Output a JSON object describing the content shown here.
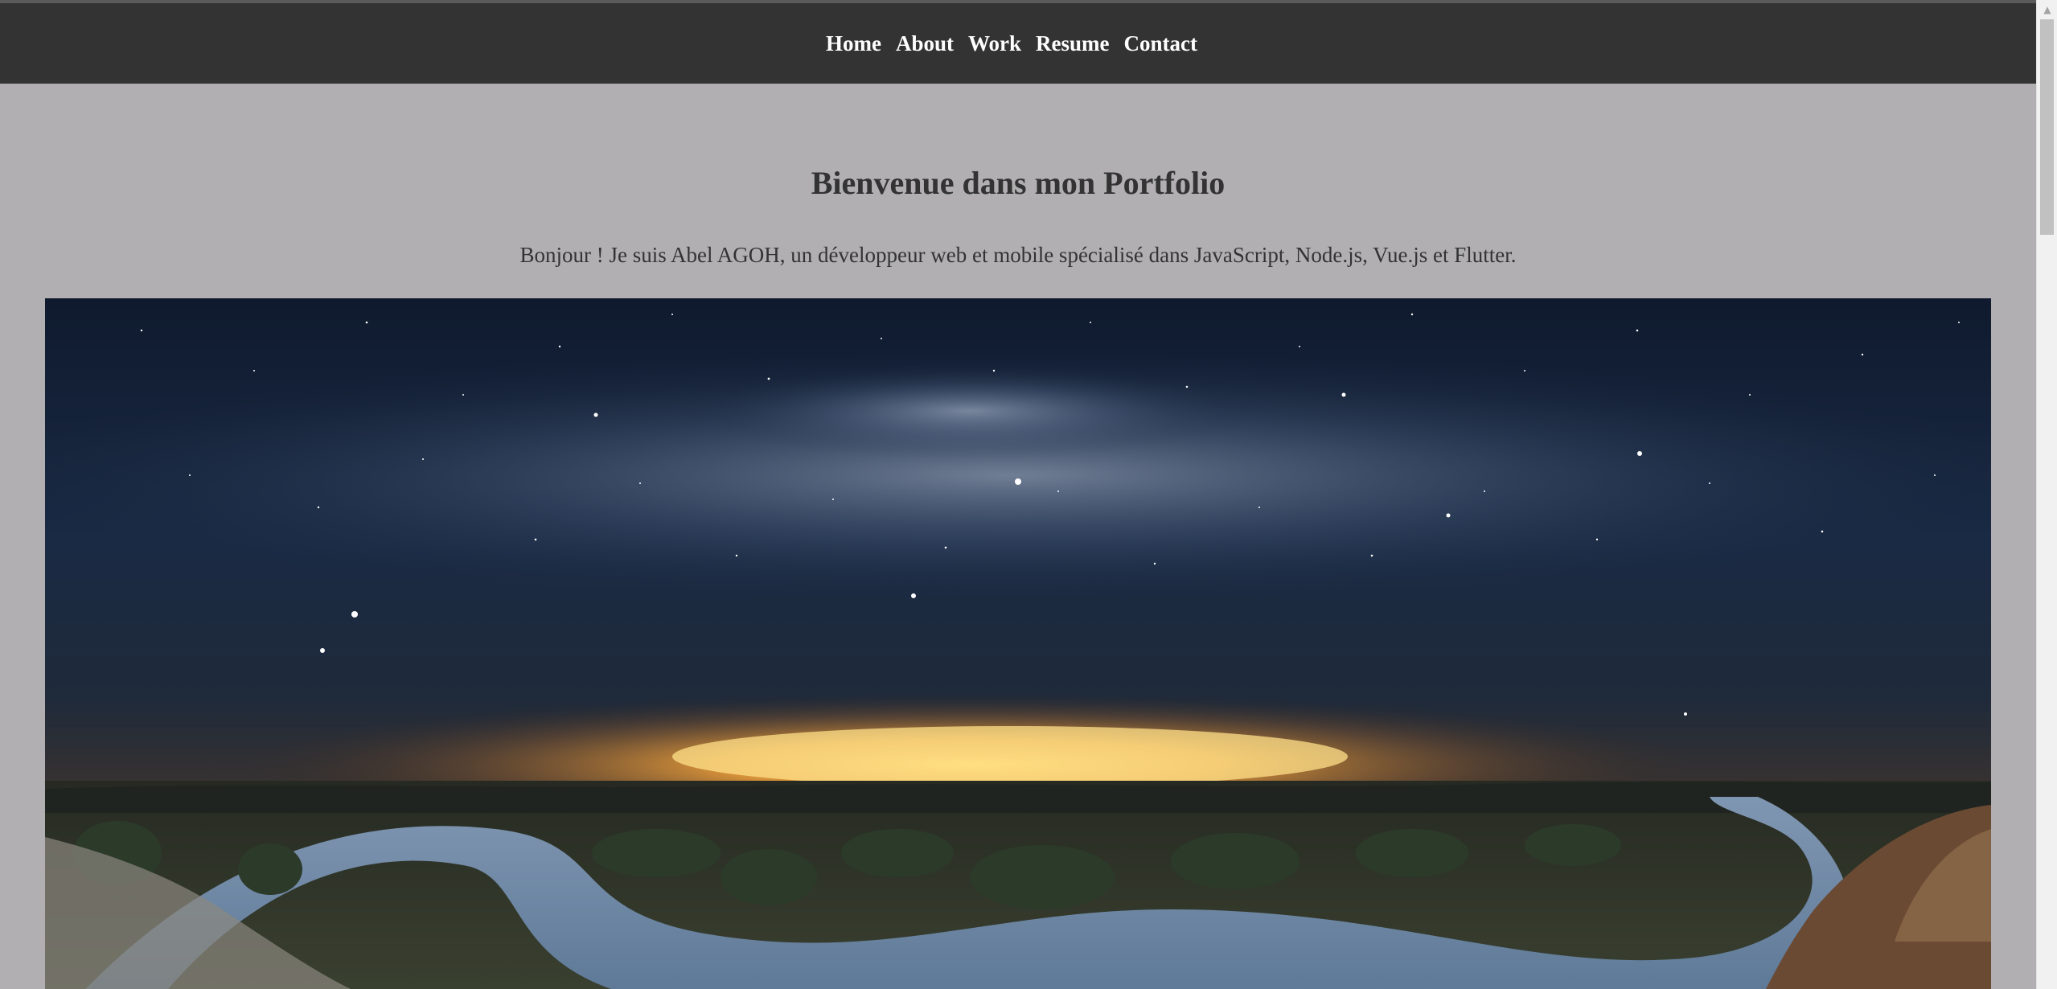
{
  "nav": {
    "items": [
      {
        "label": "Home"
      },
      {
        "label": "About"
      },
      {
        "label": "Work"
      },
      {
        "label": "Resume"
      },
      {
        "label": "Contact"
      }
    ]
  },
  "main": {
    "title": "Bienvenue dans mon Portfolio",
    "intro": "Bonjour ! Je suis Abel AGOH, un développeur web et mobile spécialisé dans JavaScript, Node.js, Vue.js et Flutter."
  },
  "scrollbar": {
    "up_icon": "arrow-up-icon"
  },
  "colors": {
    "navbar_bg": "#333333",
    "page_bg": "#b1afb2",
    "text": "#333333",
    "nav_text": "#ffffff"
  }
}
